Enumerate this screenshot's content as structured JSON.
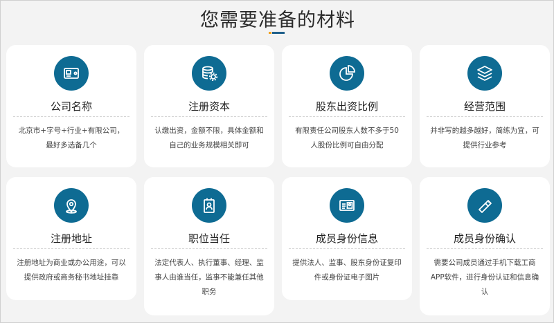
{
  "page": {
    "title": "您需要准备的材料"
  },
  "colors": {
    "icon_bg": "#0e6b93",
    "accent_orange": "#f0a01e",
    "accent_blue": "#1f5f8b"
  },
  "cards": [
    {
      "icon": "id-card-icon",
      "title": "公司名称",
      "desc": "北京市+字号+行业+有限公司，最好多选备几个"
    },
    {
      "icon": "database-gear-icon",
      "title": "注册资本",
      "desc": "认缴出资，金额不限，具体金额和自己的业务规模相关即可"
    },
    {
      "icon": "pie-chart-icon",
      "title": "股东出资比例",
      "desc": "有限责任公司股东人数不多于50人股份比例可自由分配"
    },
    {
      "icon": "layers-icon",
      "title": "经营范围",
      "desc": "并非写的越多越好，简练为宜，可提供行业参考"
    },
    {
      "icon": "location-pin-icon",
      "title": "注册地址",
      "desc": "注册地址为商业或办公用途，可以提供政府或商务秘书地址挂靠"
    },
    {
      "icon": "badge-person-icon",
      "title": "职位当任",
      "desc": "法定代表人、执行董事、经理、监事人由谁当任，监事不能兼任其他职务"
    },
    {
      "icon": "id-photo-icon",
      "title": "成员身份信息",
      "desc": "提供法人、监事、股东身份证复印件或身份证电子图片"
    },
    {
      "icon": "usb-drive-icon",
      "title": "成员身份确认",
      "desc": "需要公司成员通过手机下载工商APP软件，进行身份认证和信息确认"
    }
  ]
}
